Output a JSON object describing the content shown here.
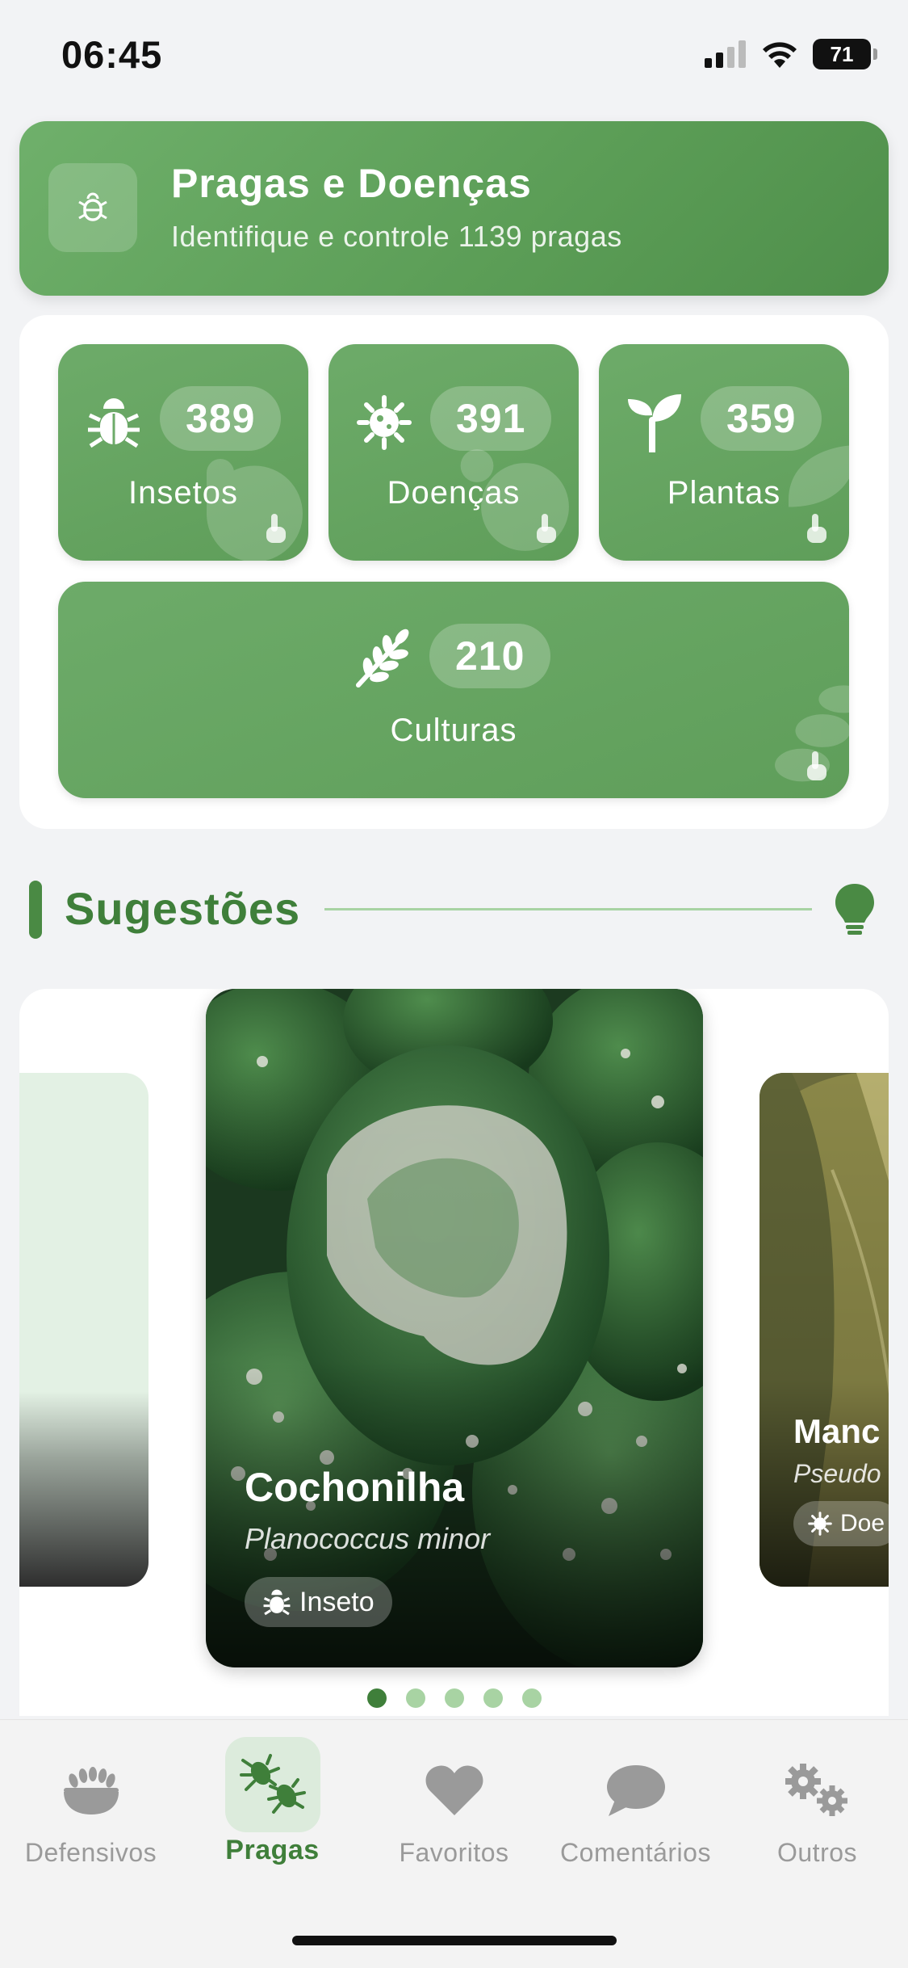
{
  "status_bar": {
    "time": "06:45",
    "battery": "71"
  },
  "header": {
    "title": "Pragas e Doenças",
    "subtitle": "Identifique e controle 1139 pragas",
    "icon": "bug-icon"
  },
  "categories": [
    {
      "label": "Insetos",
      "count": "389",
      "icon": "bug-icon"
    },
    {
      "label": "Doenças",
      "count": "391",
      "icon": "virus-icon"
    },
    {
      "label": "Plantas",
      "count": "359",
      "icon": "seedling-icon"
    },
    {
      "label": "Culturas",
      "count": "210",
      "icon": "wheat-icon"
    }
  ],
  "suggestions": {
    "title": "Sugestões",
    "icon": "lightbulb-icon",
    "cards": [
      {
        "name": "Cochonilha",
        "scientific": "Planococcus minor",
        "type": "Inseto",
        "type_icon": "bug-icon"
      },
      {
        "name": "Manc",
        "scientific": "Pseudo",
        "type": "Doe",
        "type_icon": "virus-icon"
      }
    ],
    "page_count": 5,
    "active_page": 1
  },
  "nav": [
    {
      "label": "Defensivos",
      "icon": "seeds-bowl-icon",
      "active": false
    },
    {
      "label": "Pragas",
      "icon": "bugs-icon",
      "active": true
    },
    {
      "label": "Favoritos",
      "icon": "heart-icon",
      "active": false
    },
    {
      "label": "Comentários",
      "icon": "comment-icon",
      "active": false
    },
    {
      "label": "Outros",
      "icon": "gears-icon",
      "active": false
    }
  ],
  "colors": {
    "primary": "#5f9e5a",
    "primary_dark": "#3f7f3a",
    "accent_light": "#a8d3a3",
    "inactive": "#9a9a9a"
  }
}
